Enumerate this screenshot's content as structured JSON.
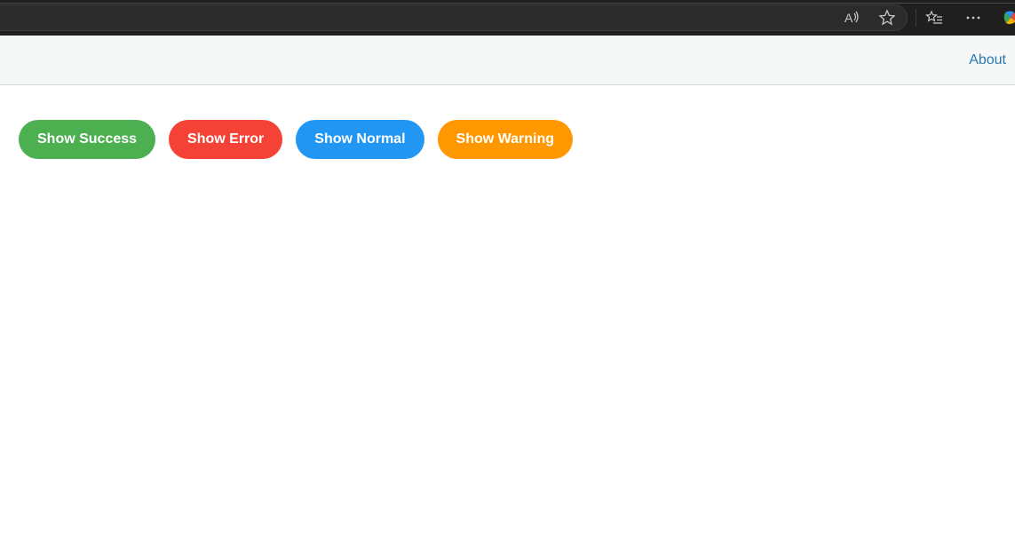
{
  "browser": {
    "toolbar_icons": [
      "read-aloud-icon",
      "favorite-star-icon",
      "favorites-list-icon",
      "more-options-icon",
      "copilot-icon"
    ]
  },
  "navbar": {
    "about_label": "About",
    "link_color": "#2a7ab0"
  },
  "buttons": [
    {
      "label": "Show Success",
      "color": "#4caf50"
    },
    {
      "label": "Show Error",
      "color": "#f44336"
    },
    {
      "label": "Show Normal",
      "color": "#2196f3"
    },
    {
      "label": "Show Warning",
      "color": "#ff9800"
    }
  ]
}
